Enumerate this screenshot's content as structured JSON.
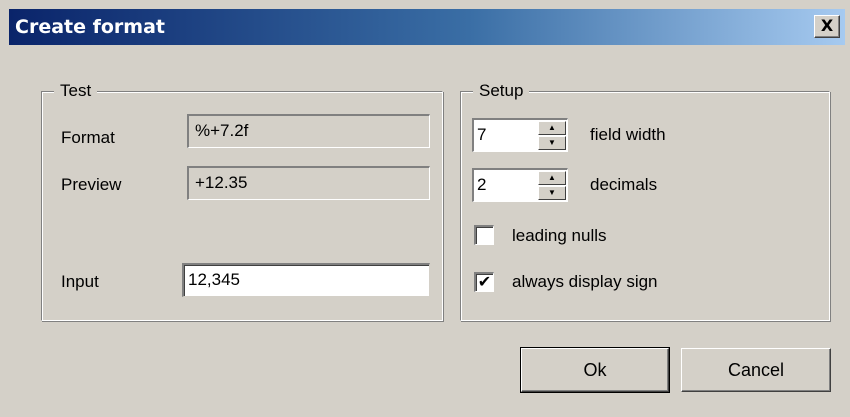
{
  "window": {
    "title": "Create format",
    "close_label": "X"
  },
  "test_group": {
    "legend": "Test",
    "format_label": "Format",
    "format_value": "%+7.2f",
    "preview_label": "Preview",
    "preview_value": "+12.35",
    "input_label": "Input",
    "input_value": "12,345"
  },
  "setup_group": {
    "legend": "Setup",
    "field_width_value": "7",
    "field_width_label": "field width",
    "decimals_value": "2",
    "decimals_label": "decimals",
    "leading_nulls_label": "leading nulls",
    "leading_nulls_checked": false,
    "always_sign_label": "always display sign",
    "always_sign_checked": true,
    "check_mark": "✔"
  },
  "buttons": {
    "ok_label": "Ok",
    "cancel_label": "Cancel"
  },
  "icons": {
    "spin_up": "▲",
    "spin_down": "▼"
  }
}
